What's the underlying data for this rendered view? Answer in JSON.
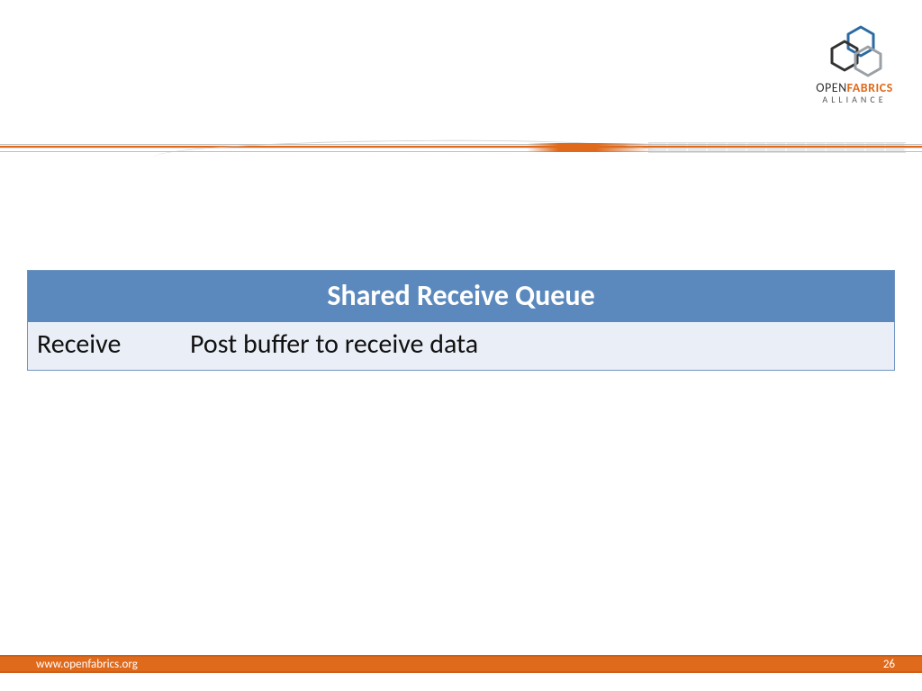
{
  "logo": {
    "line1_open": "OPEN",
    "line1_fabrics": "FABRICS",
    "line2": "ALLIANCE",
    "hex_colors": {
      "top": "#2d6aa0",
      "left": "#333333",
      "right": "#9aa0a6"
    }
  },
  "table": {
    "header": "Shared Receive Queue",
    "rows": [
      {
        "name": "Receive",
        "desc": "Post buffer to receive data"
      }
    ]
  },
  "footer": {
    "url": "www.openfabrics.org",
    "page_number": "26"
  },
  "colors": {
    "accent_orange": "#e06a1c",
    "table_header_bg": "#5b89bd",
    "table_body_bg": "#eaeff7",
    "table_border": "#6f93c1"
  }
}
